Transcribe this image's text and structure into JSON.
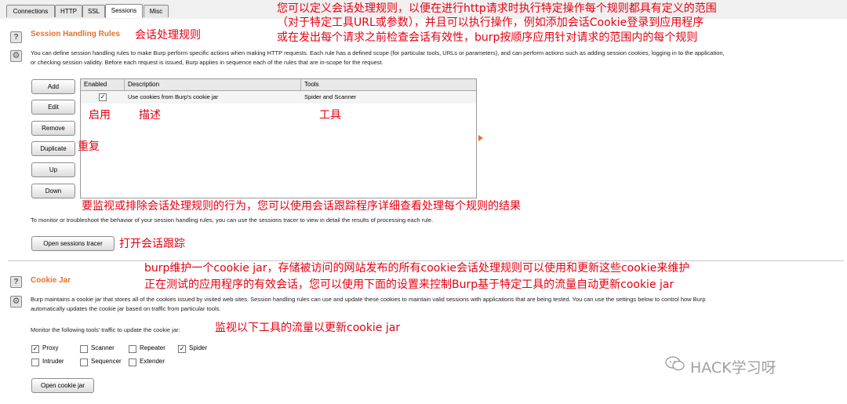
{
  "tabs": [
    "Connections",
    "HTTP",
    "SSL",
    "Sessions",
    "Misc"
  ],
  "active_tab": "Sessions",
  "session_handling": {
    "title": "Session Handling Rules",
    "description_line1": "You can define session handling rules to make Burp perform specific actions when making HTTP requests. Each rule has a defined scope (for particular tools, URLs or parameters), and can perform actions such as adding session cookies, logging in to the application,",
    "description_line2": "or checking session validity. Before each request is issued, Burp applies in sequence each of the rules that are in-scope for the request.",
    "buttons": {
      "add": "Add",
      "edit": "Edit",
      "remove": "Remove",
      "duplicate": "Duplicate",
      "up": "Up",
      "down": "Down"
    },
    "columns": [
      "Enabled",
      "Description",
      "Tools"
    ],
    "rows": [
      {
        "enabled": true,
        "description": "Use cookies from Burp's cookie jar",
        "tools": "Spider and Scanner"
      }
    ],
    "tracer_text": "To monitor or troubleshoot the behavior of your session handling rules, you can use the sessions tracer to view in detail the results of processing each rule.",
    "open_tracer_label": "Open sessions tracer"
  },
  "cookie_jar": {
    "title": "Cookie Jar",
    "description_line1": "Burp maintains a cookie jar that stores all of the cookies issued by visited web sites. Session handling rules can use and update these cookies to maintain valid sessions with applications that are being tested. You can use the settings below to control how Burp",
    "description_line2": "automatically updates the cookie jar based on traffic from particular tools.",
    "monitor_label": "Monitor the following tools' traffic to update the cookie jar:",
    "tools": [
      {
        "label": "Proxy",
        "checked": true
      },
      {
        "label": "Scanner",
        "checked": false
      },
      {
        "label": "Repeater",
        "checked": false
      },
      {
        "label": "Spider",
        "checked": true
      },
      {
        "label": "Intruder",
        "checked": false
      },
      {
        "label": "Sequencer",
        "checked": false
      },
      {
        "label": "Extender",
        "checked": false
      }
    ],
    "open_cookie_jar_label": "Open cookie jar"
  },
  "annotations": {
    "top_line1": "您可以定义会话处理规则，以便在进行http请求时执行特定操作每个规则都具有定义的范围",
    "top_line2": "（对于特定工具URL或参数），并且可以执行操作，例如添加会话Cookie登录到应用程序",
    "top_line3": "或在发出每个请求之前检查会话有效性，burp按顺序应用针对请求的范围内的每个规则",
    "session_rules": "会话处理规则",
    "enabled": "启用",
    "description": "描述",
    "tools": "工具",
    "duplicate": "重复",
    "tracer_note": "要监视或排除会话处理规则的行为，您可以使用会话跟踪程序详细查看处理每个规则的结果",
    "open_tracer": "打开会话跟踪",
    "cookie_line1": "burp维护一个cookie jar，存储被访问的网站发布的所有cookie会话处理规则可以使用和更新这些cookie来维护",
    "cookie_line2": "正在测试的应用程序的有效会话，您可以使用下面的设置来控制Burp基于特定工具的流量自动更新cookie jar",
    "monitor_note": "监视以下工具的流量以更新cookie jar"
  },
  "watermark": "HACK学习呀",
  "colors": {
    "section_title": "#e8702a",
    "annotation": "#e60012"
  }
}
